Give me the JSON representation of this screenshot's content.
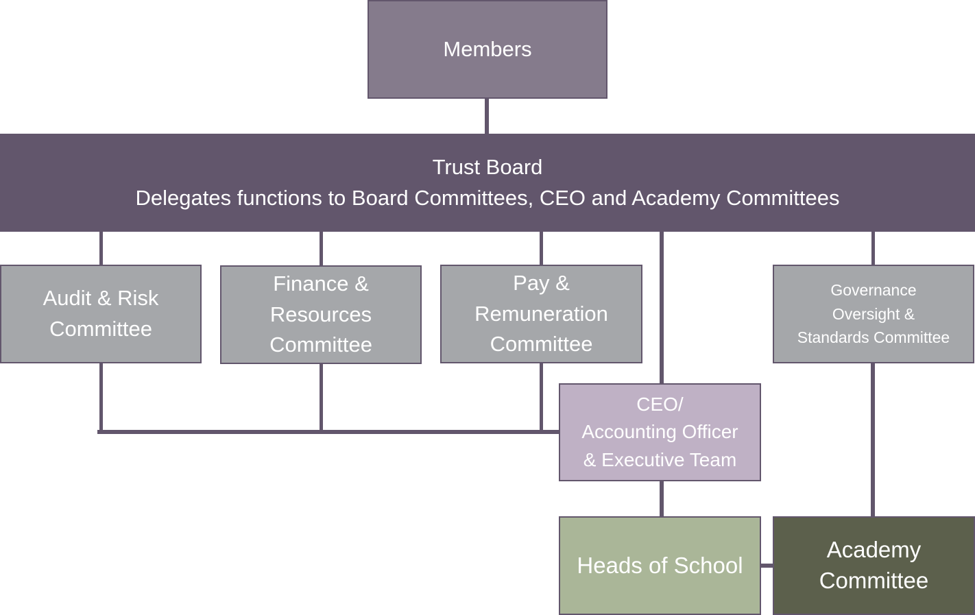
{
  "diagram": {
    "type": "organisational-chart",
    "colors": {
      "connector": "#62566c",
      "members": "#857b8c",
      "trust_board": "#62566c",
      "committee": "#a5a7aa",
      "ceo": "#bfb1c5",
      "heads_of_school": "#aab698",
      "academy_committee": "#5c604c",
      "text": "#ffffff"
    },
    "nodes": {
      "members": {
        "label": "Members"
      },
      "trust_board": {
        "title": "Trust Board",
        "subtitle": "Delegates functions to Board Committees, CEO and Academy Committees"
      },
      "audit_risk": {
        "label": "Audit & Risk\nCommittee"
      },
      "finance_resources": {
        "label": "Finance &\nResources\nCommittee"
      },
      "pay_remuneration": {
        "label": "Pay &\nRemuneration\nCommittee"
      },
      "governance_oversight": {
        "label": "Governance\nOversight &\nStandards Committee"
      },
      "ceo": {
        "label": "CEO/\nAccounting Officer\n& Executive Team"
      },
      "heads_of_school": {
        "label": "Heads of School"
      },
      "academy_committee": {
        "label": "Academy\nCommittee"
      }
    },
    "edges": [
      {
        "from": "members",
        "to": "trust_board"
      },
      {
        "from": "trust_board",
        "to": "audit_risk"
      },
      {
        "from": "trust_board",
        "to": "finance_resources"
      },
      {
        "from": "trust_board",
        "to": "pay_remuneration"
      },
      {
        "from": "trust_board",
        "to": "ceo"
      },
      {
        "from": "trust_board",
        "to": "governance_oversight"
      },
      {
        "from": "audit_risk",
        "to": "ceo"
      },
      {
        "from": "finance_resources",
        "to": "ceo"
      },
      {
        "from": "pay_remuneration",
        "to": "ceo"
      },
      {
        "from": "ceo",
        "to": "heads_of_school"
      },
      {
        "from": "governance_oversight",
        "to": "academy_committee"
      },
      {
        "from": "heads_of_school",
        "to": "academy_committee"
      }
    ]
  }
}
